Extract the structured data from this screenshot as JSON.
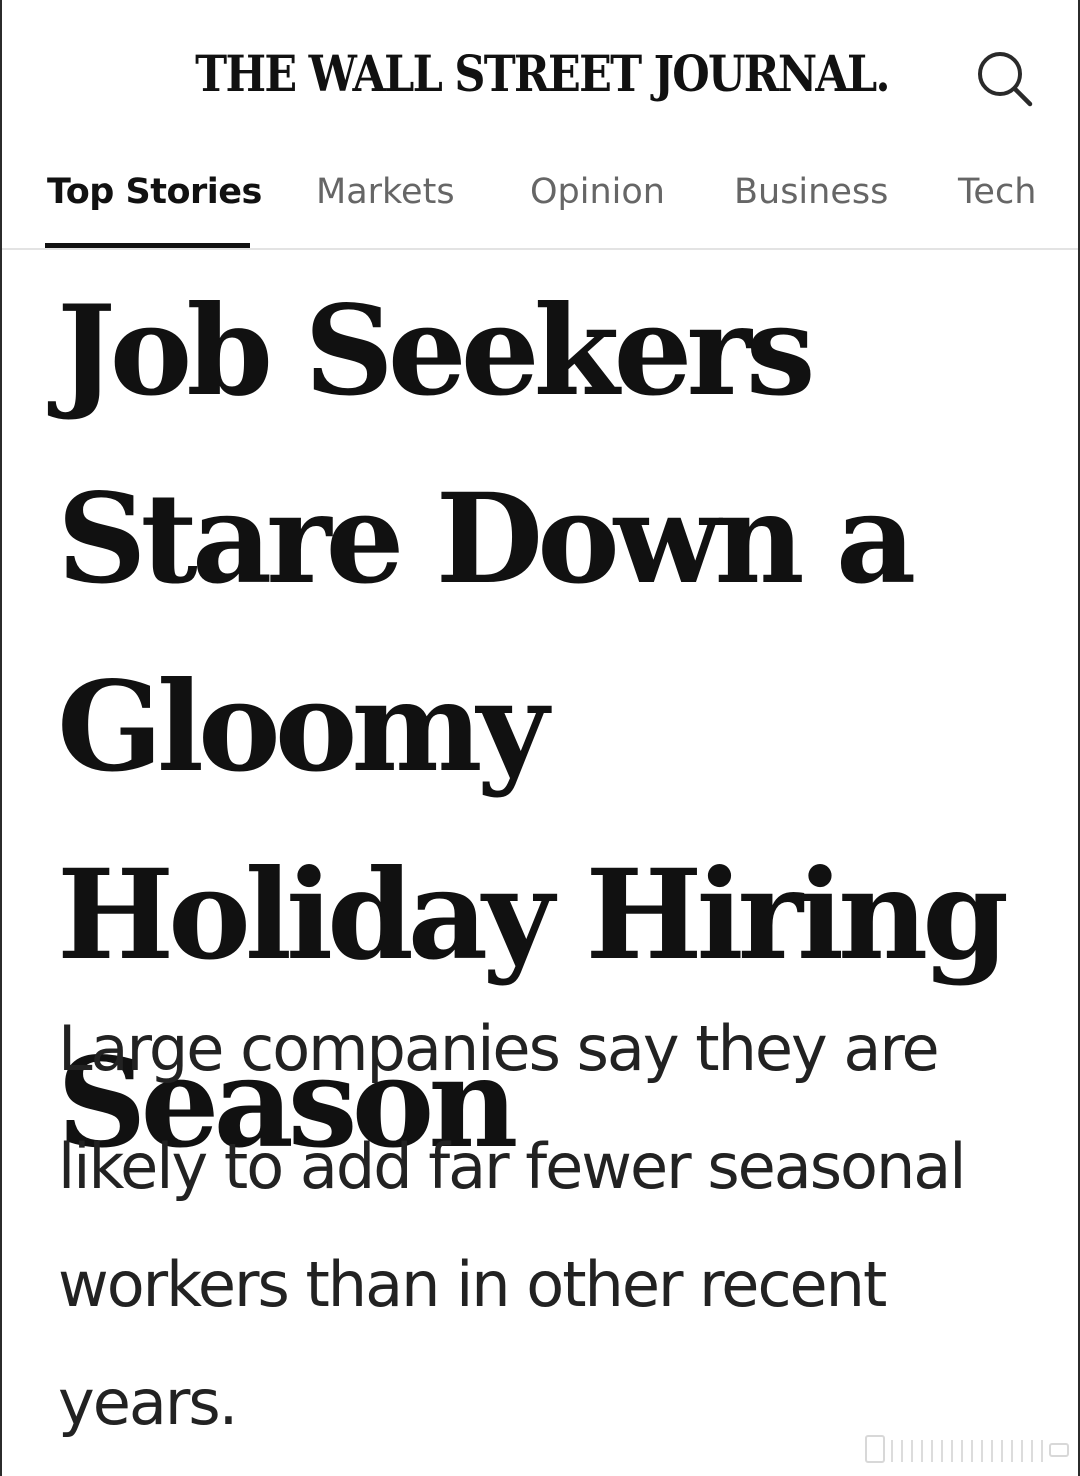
{
  "masthead": {
    "title": "THE WALL STREET JOURNAL.",
    "search_icon": "search-icon"
  },
  "nav": {
    "tabs": [
      {
        "label": "Top Stories",
        "active": true
      },
      {
        "label": "Markets",
        "active": false
      },
      {
        "label": "Opinion",
        "active": false
      },
      {
        "label": "Business",
        "active": false
      },
      {
        "label": "Tech",
        "active": false
      }
    ]
  },
  "article": {
    "headline": "Job Seekers Stare Down a Gloomy Holiday Hiring Season",
    "dek": "Large companies say they are likely to add far fewer seasonal workers than in other recent years."
  },
  "colors": {
    "text": "#111111",
    "tab_inactive": "#666666",
    "tab_underline": "#111111",
    "divider": "#e3e3e3"
  }
}
